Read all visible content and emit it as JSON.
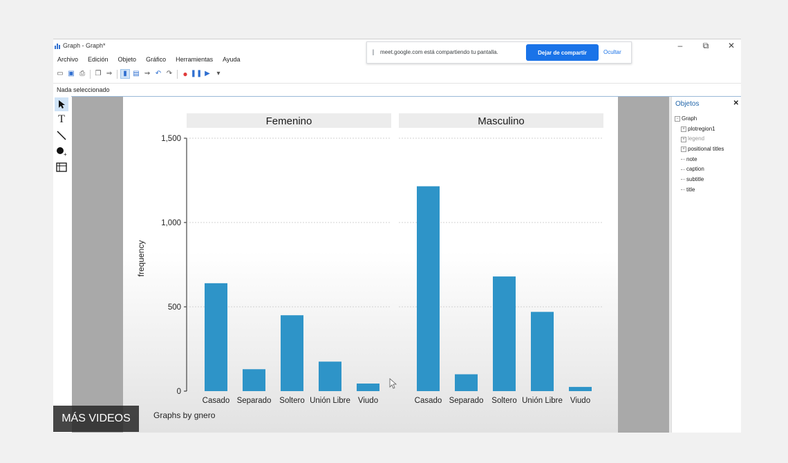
{
  "window": {
    "title": "Graph - Graph*",
    "controls": {
      "minimize": "–",
      "restore": "⧉",
      "close": "✕"
    }
  },
  "menu": [
    "Archivo",
    "Edición",
    "Objeto",
    "Gráfico",
    "Herramientas",
    "Ayuda"
  ],
  "toolbar": {
    "icons": [
      "open-icon",
      "save-icon",
      "print-icon",
      "copy-icon",
      "rename-icon",
      "graph-editor-icon",
      "data-icon",
      "pointer-icon",
      "undo-icon",
      "redo-icon",
      "record-icon",
      "pause-icon",
      "play-icon",
      "dropdown-icon"
    ]
  },
  "status": {
    "selection": "Nada seleccionado"
  },
  "share_banner": {
    "message": "meet.google.com está compartiendo tu pantalla.",
    "stop_label": "Dejar de compartir",
    "hide_label": "Ocultar"
  },
  "tools": [
    "pointer-tool-icon",
    "text-tool-icon",
    "line-tool-icon",
    "marker-tool-icon",
    "grid-tool-icon"
  ],
  "objects_panel": {
    "title": "Objetos",
    "close": "✕",
    "tree": [
      {
        "label": "Graph",
        "level": 0,
        "expander": "−"
      },
      {
        "label": "plotregion1",
        "level": 1,
        "expander": "+"
      },
      {
        "label": "legend",
        "level": 1,
        "expander": "+",
        "dim": true
      },
      {
        "label": "positional titles",
        "level": 1,
        "expander": "+"
      },
      {
        "label": "note",
        "level": 1
      },
      {
        "label": "caption",
        "level": 1
      },
      {
        "label": "subtitle",
        "level": 1
      },
      {
        "label": "title",
        "level": 1
      }
    ]
  },
  "chart_data": {
    "type": "bar",
    "ylabel": "frequency",
    "ylim": [
      0,
      1500
    ],
    "yticks": [
      0,
      500,
      1000,
      1500
    ],
    "ytick_labels": [
      "0",
      "500",
      "1,000",
      "1,500"
    ],
    "note": "Graphs by gnero",
    "bar_color": "#2e94c8",
    "categories": [
      "Casado",
      "Separado",
      "Soltero",
      "Unión Libre",
      "Viudo"
    ],
    "panels": [
      {
        "name": "Femenino",
        "values": [
          640,
          130,
          450,
          175,
          45
        ]
      },
      {
        "name": "Masculino",
        "values": [
          1215,
          100,
          680,
          470,
          25
        ]
      }
    ]
  },
  "overlay": {
    "label": "MÁS VIDEOS"
  }
}
